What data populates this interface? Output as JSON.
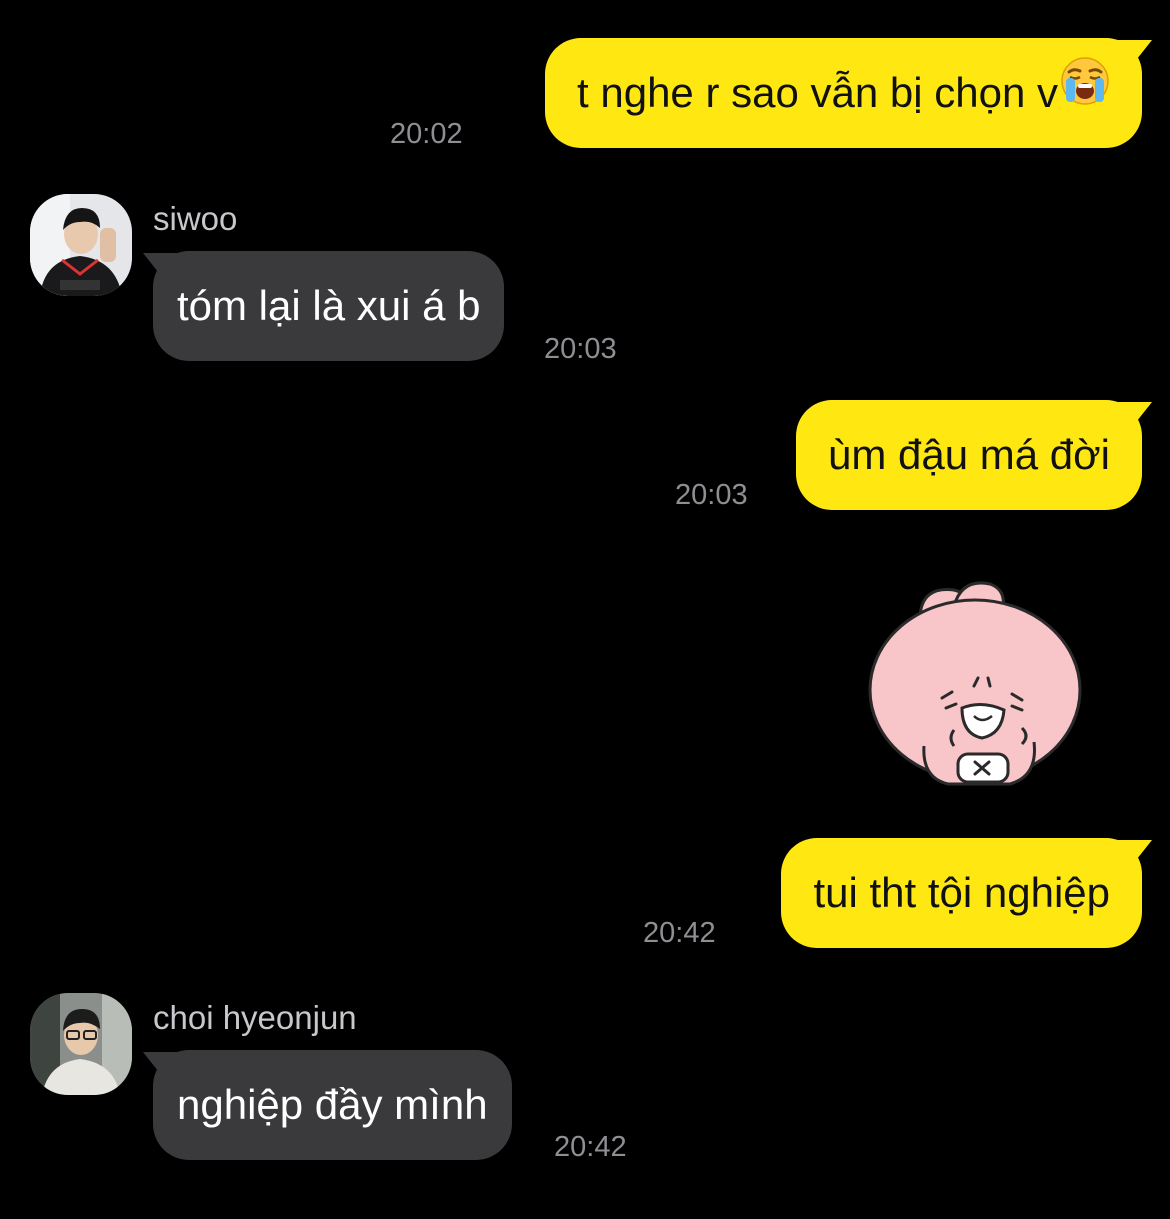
{
  "messages": [
    {
      "type": "outgoing",
      "text": "t nghe r sao vẫn bị chọn v",
      "emoji": "loudly-crying-face-emoji",
      "time": "20:02"
    },
    {
      "type": "incoming",
      "sender": "siwoo",
      "text": "tóm lại là xui á b",
      "time": "20:03"
    },
    {
      "type": "outgoing",
      "text": "ùm đậu má đời",
      "time": "20:03"
    },
    {
      "type": "sticker",
      "icon": "pink-crying-bunny-sticker"
    },
    {
      "type": "outgoing",
      "text": "tui tht tội nghiệp",
      "time": "20:42"
    },
    {
      "type": "incoming",
      "sender": "choi hyeonjun",
      "text": "nghiệp đầy mình",
      "time": "20:42"
    }
  ],
  "colors": {
    "background": "#000000",
    "outgoing_bubble": "#FFE812",
    "incoming_bubble": "#3A3A3C",
    "timestamp": "#8E8E93",
    "sender_name": "#C7C7CC"
  }
}
